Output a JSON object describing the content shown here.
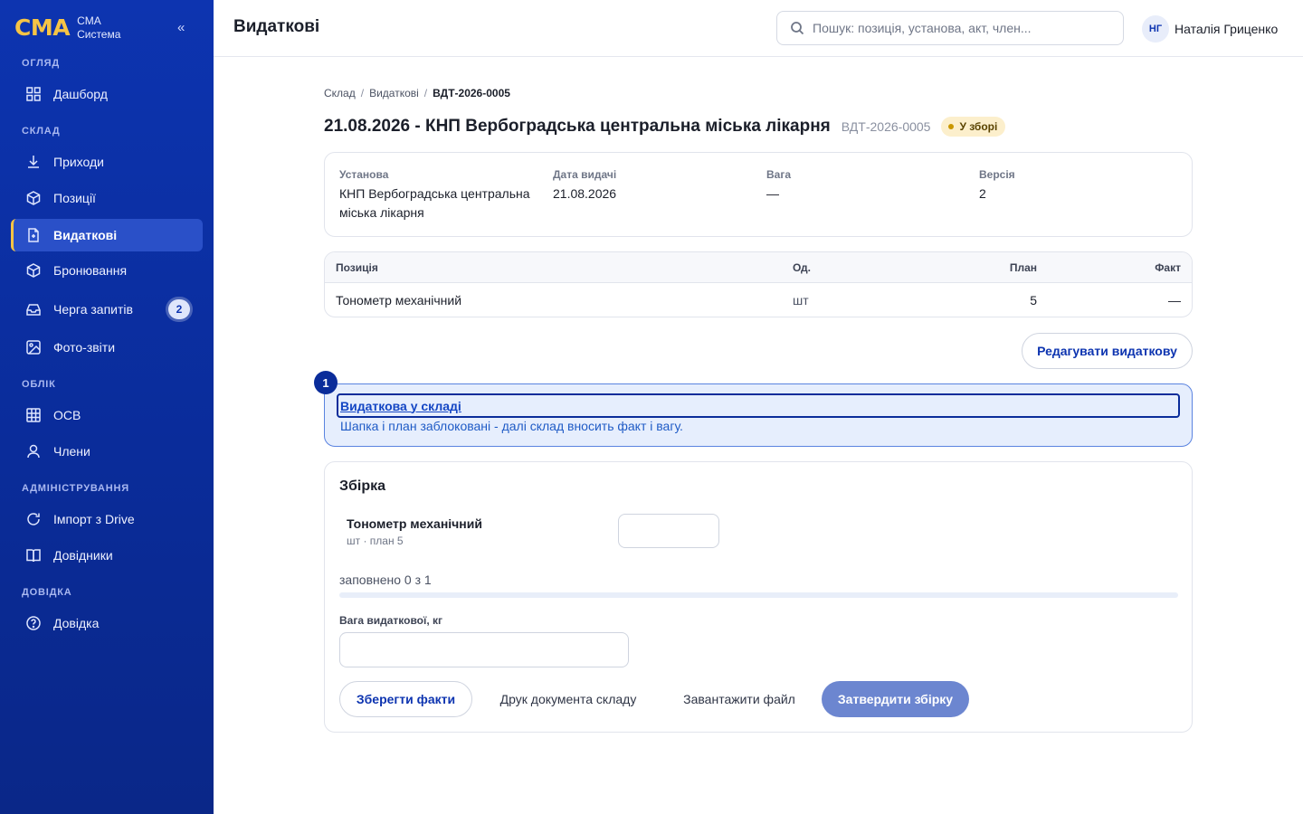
{
  "brand": {
    "logo": "CMA",
    "line1": "CMA",
    "line2": "Система",
    "collapse": "«"
  },
  "sidebar": {
    "sections": [
      {
        "title": "Огляд"
      },
      {
        "title": "Склад"
      },
      {
        "title": "Облік"
      },
      {
        "title": "Адміністрування"
      },
      {
        "title": "Довідка"
      }
    ],
    "items": [
      {
        "label": "Дашборд",
        "icon": "dashboard-icon"
      },
      {
        "label": "Приходи",
        "icon": "download-icon"
      },
      {
        "label": "Позиції",
        "icon": "box-icon"
      },
      {
        "label": "Видаткові",
        "icon": "document-icon",
        "active": true
      },
      {
        "label": "Бронювання",
        "icon": "box-icon"
      },
      {
        "label": "Черга запитів",
        "icon": "inbox-icon",
        "badge": "2"
      },
      {
        "label": "Фото-звіти",
        "icon": "image-icon"
      },
      {
        "label": "ОСВ",
        "icon": "grid-icon"
      },
      {
        "label": "Члени",
        "icon": "user-icon"
      },
      {
        "label": "Імпорт з Drive",
        "icon": "refresh-icon"
      },
      {
        "label": "Довідники",
        "icon": "book-icon"
      },
      {
        "label": "Довідка",
        "icon": "help-icon"
      }
    ]
  },
  "header": {
    "title": "Видаткові",
    "search_placeholder": "Пошук: позиція, установа, акт, член...",
    "user_initials": "НГ",
    "user_name": "Наталія Гриценко"
  },
  "breadcrumb": [
    "Склад",
    "Видаткові",
    "ВДТ-2026-0005"
  ],
  "doc": {
    "title": "21.08.2026 - КНП Вербоградська центральна міська лікарня",
    "number": "ВДТ-2026-0005",
    "status": "У зборі",
    "status_color": "#fcefcc"
  },
  "info": [
    {
      "label": "Установа",
      "value": "КНП Вербоградська центральна міська лікарня"
    },
    {
      "label": "Дата видачі",
      "value": "21.08.2026"
    },
    {
      "label": "Вага",
      "value": "—"
    },
    {
      "label": "Версія",
      "value": "2"
    }
  ],
  "table": {
    "headers": [
      "Позиція",
      "Од.",
      "План",
      "Факт"
    ],
    "rows": [
      [
        "Тонометр механічний",
        "шт",
        "5",
        "—"
      ]
    ]
  },
  "edit_button": "Редагувати видаткову",
  "notice": {
    "step": "1",
    "title": "Видаткова у складі",
    "text": "Шапка і план заблоковані - далі склад вносить факт і вагу."
  },
  "assembly": {
    "title": "Збірка",
    "item_name": "Тонометр механічний",
    "item_sub": "шт · план 5",
    "fact_value": "",
    "progress_text": "заповнено 0 з 1",
    "progress": 0,
    "weight_label": "Вага видаткової, кг",
    "weight_value": "",
    "buttons": {
      "save": "Зберегти факти",
      "print": "Друк документа складу",
      "upload": "Завантажити файл",
      "approve": "Затвердити збірку"
    }
  },
  "colors": {
    "sidebar": "#0d34b0",
    "accent": "#f6c445",
    "primary": "#0d34b0",
    "notice_bg": "#e6eefd"
  }
}
